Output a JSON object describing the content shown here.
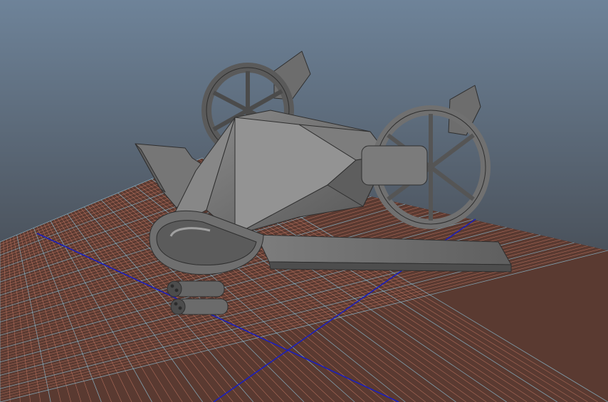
{
  "viewport": {
    "background_top": "#6c8298",
    "background_bottom": "#2a2d31"
  },
  "grid": {
    "floor_color": "#5c3b32",
    "line_color": "#c97b66",
    "major_line_color": "#8fc4da",
    "axis_color": "#1b1dbd"
  },
  "model": {
    "body_color": "#6f6f6f",
    "light_color": "#9a9a9a",
    "dark_color": "#3f3f3f"
  }
}
